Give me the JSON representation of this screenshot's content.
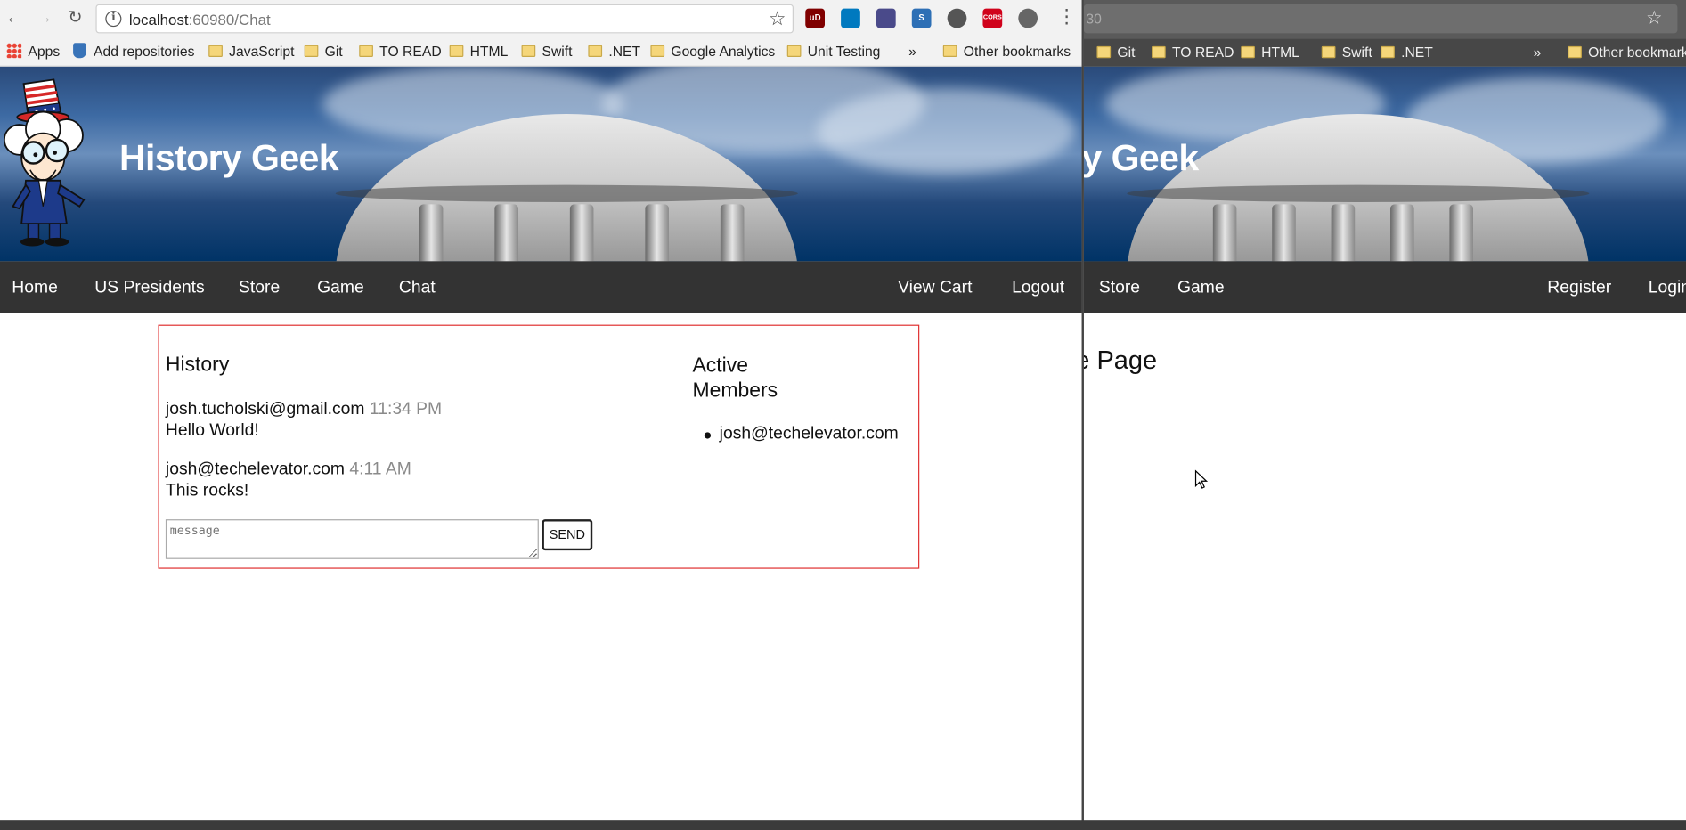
{
  "browser": {
    "url_host": "localhost",
    "url_path": ":60980/Chat",
    "bookmarks": [
      {
        "label": "Apps",
        "icon": "apps-grid-icon"
      },
      {
        "label": "Add repositories",
        "icon": "bucket-icon"
      },
      {
        "label": "JavaScript",
        "icon": "folder-icon"
      },
      {
        "label": "Git",
        "icon": "folder-icon"
      },
      {
        "label": "TO READ",
        "icon": "folder-icon"
      },
      {
        "label": "HTML",
        "icon": "folder-icon"
      },
      {
        "label": "Swift",
        "icon": "folder-icon"
      },
      {
        "label": ".NET",
        "icon": "folder-icon"
      },
      {
        "label": "Google Analytics",
        "icon": "folder-icon"
      },
      {
        "label": "Unit Testing",
        "icon": "folder-icon"
      }
    ],
    "overflow": "»",
    "other_bookmarks": "Other bookmarks",
    "extensions": [
      {
        "name": "ublock-icon",
        "text": "uD",
        "color": "#800000"
      },
      {
        "name": "trello-icon",
        "text": "",
        "color": "#0079bf"
      },
      {
        "name": "eyedropper-icon",
        "text": "",
        "color": "#4a4a8a"
      },
      {
        "name": "s-icon",
        "text": "S",
        "color": "#2d6fb5"
      },
      {
        "name": "cookie-icon",
        "text": "",
        "color": "#555555"
      },
      {
        "name": "cors-icon",
        "text": "CORS",
        "color": "#d0021b"
      },
      {
        "name": "spiral-icon",
        "text": "",
        "color": "#666666"
      }
    ]
  },
  "site": {
    "title": "History Geek",
    "nav_left": [
      "Home",
      "US Presidents",
      "Store",
      "Game",
      "Chat"
    ],
    "nav_right": [
      "View Cart",
      "Logout"
    ]
  },
  "chat": {
    "history_heading": "History",
    "messages": [
      {
        "user": "josh.tucholski@gmail.com",
        "time": "11:34 PM",
        "text": "Hello World!"
      },
      {
        "user": "josh@techelevator.com",
        "time": "4:11 AM",
        "text": "This rocks!"
      }
    ],
    "input_placeholder": "message",
    "send_label": "SEND",
    "active_heading": "Active Members",
    "active_members": [
      "josh@techelevator.com"
    ]
  },
  "background_window": {
    "url_fragment": "30",
    "bookmarks": [
      "Git",
      "TO READ",
      "HTML",
      "Swift",
      ".NET"
    ],
    "overflow": "»",
    "other_bookmarks": "Other bookmarks",
    "title_fragment": "y Geek",
    "nav_left": [
      "Store",
      "Game"
    ],
    "nav_right": [
      "Register",
      "Login"
    ],
    "heading_fragment": "e Page"
  },
  "colors": {
    "nav_bg": "#333333",
    "header_bg": "#003366",
    "panel_border": "#e03131",
    "timestamp": "#8a8a8a"
  }
}
